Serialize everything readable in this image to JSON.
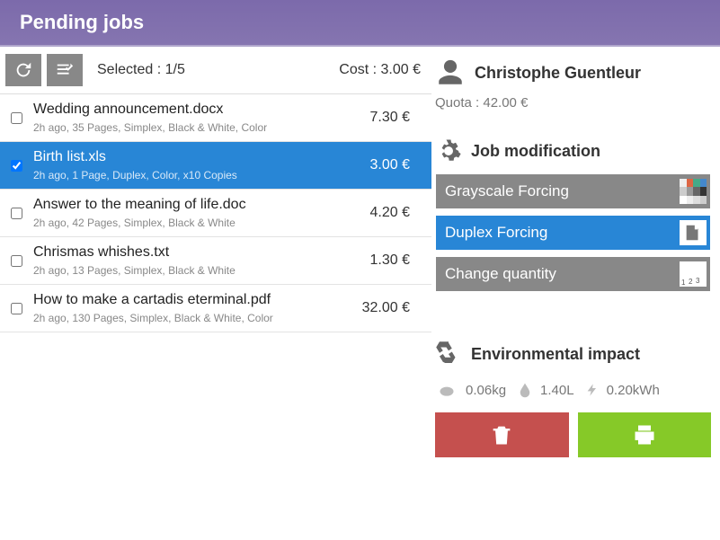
{
  "header": {
    "title": "Pending jobs"
  },
  "toolbar": {
    "selected_label": "Selected : 1/5",
    "cost_label": "Cost : 3.00 €"
  },
  "jobs": [
    {
      "title": "Wedding announcement.docx",
      "meta": "2h ago, 35 Pages, Simplex, Black & White, Color",
      "cost": "7.30 €",
      "selected": false
    },
    {
      "title": "Birth list.xls",
      "meta": "2h ago, 1 Page, Duplex, Color, x10 Copies",
      "cost": "3.00 €",
      "selected": true
    },
    {
      "title": "Answer to the meaning of life.doc",
      "meta": "2h ago, 42 Pages, Simplex, Black & White",
      "cost": "4.20 €",
      "selected": false
    },
    {
      "title": "Chrismas whishes.txt",
      "meta": "2h ago, 13 Pages, Simplex, Black & White",
      "cost": "1.30 €",
      "selected": false
    },
    {
      "title": "How to make a cartadis eterminal.pdf",
      "meta": "2h ago, 130 Pages, Simplex, Black & White, Color",
      "cost": "32.00 €",
      "selected": false
    }
  ],
  "user": {
    "name": "Christophe Guentleur",
    "quota": "Quota : 42.00 €"
  },
  "mod": {
    "title": "Job modification",
    "grayscale": "Grayscale Forcing",
    "duplex": "Duplex Forcing",
    "quantity": "Change quantity"
  },
  "env": {
    "title": "Environmental impact",
    "co2": "0.06kg",
    "water": "1.40L",
    "energy": "0.20kWh"
  }
}
